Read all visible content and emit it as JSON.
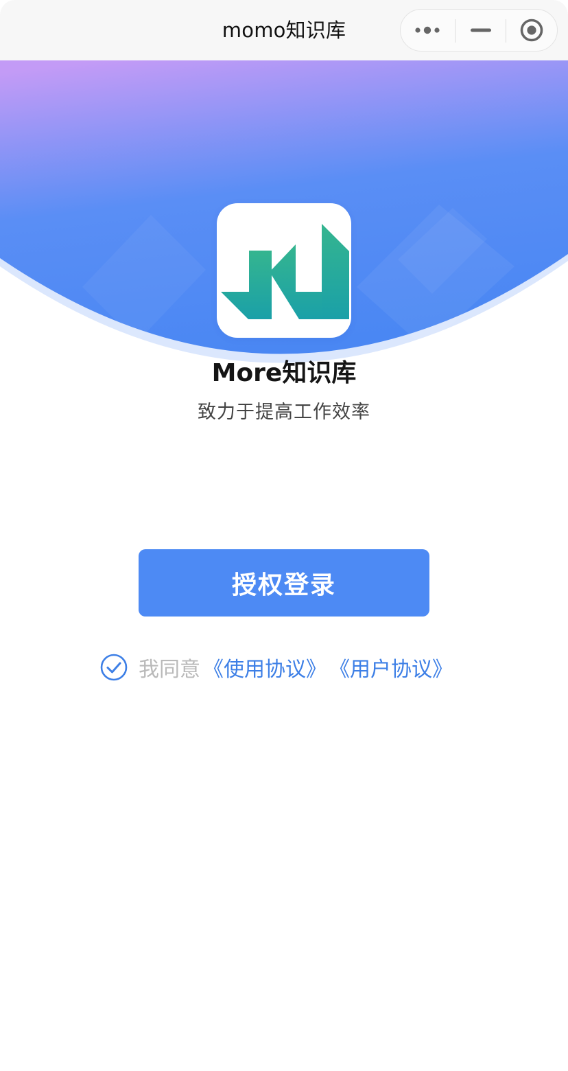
{
  "navbar": {
    "title": "momo知识库",
    "capsule": {
      "more_icon": "more-dots-icon",
      "minimize_icon": "minimize-icon",
      "close_icon": "close-target-icon"
    }
  },
  "hero": {
    "gradient_top": "#c39bf6",
    "gradient_bottom": "#4a87f3",
    "rim_color": "#dbe7fd",
    "logo_colors": [
      "#35b58f",
      "#1aa0a8"
    ]
  },
  "app": {
    "name": "More知识库",
    "tagline": "致力于提高工作效率"
  },
  "login": {
    "button_label": "授权登录",
    "color": "#4d8af4"
  },
  "agreement": {
    "checked": true,
    "prefix": "我同意",
    "terms_link": "《使用协议》",
    "user_link": "《用户协议》",
    "link_color": "#3d7fe6"
  }
}
